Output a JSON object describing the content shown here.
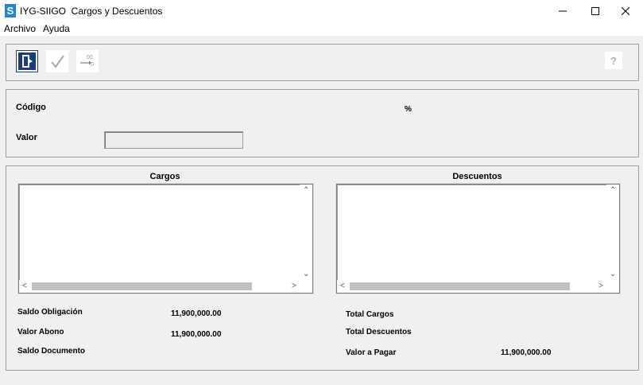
{
  "window": {
    "title": "IYG-SIIGO  Cargos y Descuentos",
    "app_icon_letter": "S"
  },
  "menu": {
    "items": [
      "Archivo",
      "Ayuda"
    ]
  },
  "toolbar": {
    "help_label": "?"
  },
  "form": {
    "codigo_label": "Código",
    "percent_label": "%",
    "valor_label": "Valor",
    "valor_value": ""
  },
  "lists": {
    "cargos_title": "Cargos",
    "descuentos_title": "Descuentos"
  },
  "summary": {
    "saldo_obligacion_label": "Saldo Obligación",
    "saldo_obligacion_value": "11,900,000.00",
    "valor_abono_label": "Valor Abono",
    "valor_abono_value": "11,900,000.00",
    "saldo_documento_label": "Saldo Documento",
    "total_cargos_label": "Total Cargos",
    "total_descuentos_label": "Total Descuentos",
    "valor_pagar_label": "Valor a Pagar",
    "valor_pagar_value": "11,900,000.00"
  },
  "icons": {
    "app": "siigo-app-icon",
    "exit": "exit-door-icon",
    "confirm": "checkmark-icon",
    "calc": "calculate-icon",
    "help": "help-icon"
  },
  "colors": {
    "app_icon": "#1e88d3",
    "exit_border": "#1a3e7a"
  }
}
